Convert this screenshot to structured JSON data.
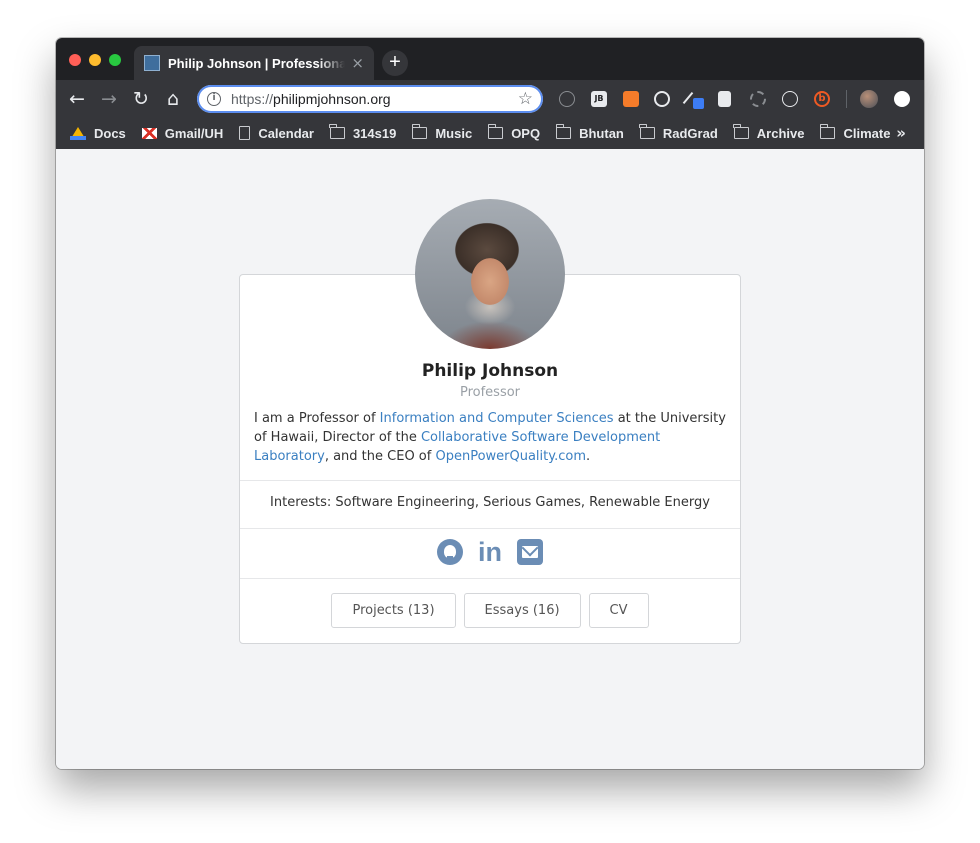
{
  "browser": {
    "tab": {
      "title": "Philip Johnson | Professional Portfolio",
      "close": "×"
    },
    "new_tab": "+",
    "nav": {
      "back": "←",
      "forward": "→",
      "reload": "↻",
      "home": "⌂"
    },
    "omnibox": {
      "scheme": "https://",
      "host": "philipmjohnson.org",
      "star": "☆"
    },
    "extensions": [
      "info-icon",
      "jetbrains-icon",
      "chart-icon",
      "gauge-icon",
      "pen-icon",
      "document-icon",
      "sync-icon",
      "react-icon",
      "b-icon",
      "profile-avatar",
      "menu-dot"
    ],
    "extension_labels": {
      "jb": "JB",
      "b": "b"
    },
    "bookmarks": [
      {
        "label": "Docs",
        "icon": "drive-icon"
      },
      {
        "label": "Gmail/UH",
        "icon": "gmail-icon"
      },
      {
        "label": "Calendar",
        "icon": "page-icon"
      },
      {
        "label": "314s19",
        "icon": "folder-icon"
      },
      {
        "label": "Music",
        "icon": "folder-icon"
      },
      {
        "label": "OPQ",
        "icon": "folder-icon"
      },
      {
        "label": "Bhutan",
        "icon": "folder-icon"
      },
      {
        "label": "RadGrad",
        "icon": "folder-icon"
      },
      {
        "label": "Archive",
        "icon": "folder-icon"
      },
      {
        "label": "Climate",
        "icon": "folder-icon"
      }
    ],
    "bookmarks_more": "»"
  },
  "profile": {
    "name": "Philip Johnson",
    "title": "Professor",
    "bio": {
      "p1": "I am a Professor of ",
      "link1": "Information and Computer Sciences",
      "p2": " at the University of Hawaii, Director of the ",
      "link2": "Collaborative Software Development Laboratory",
      "p3": ", and the CEO of ",
      "link3": "OpenPowerQuality.com",
      "p4": "."
    },
    "interests": "Interests: Software Engineering, Serious Games, Renewable Energy",
    "social": [
      "github-icon",
      "linkedin-icon",
      "email-icon"
    ],
    "linkedin_glyph": "in",
    "buttons": {
      "projects": "Projects (13)",
      "essays": "Essays (16)",
      "cv": "CV"
    }
  },
  "colors": {
    "accent": "#6b8db5",
    "link": "#3a7fc1",
    "chrome_dark": "#35363a",
    "page_bg": "#f3f4f6"
  }
}
